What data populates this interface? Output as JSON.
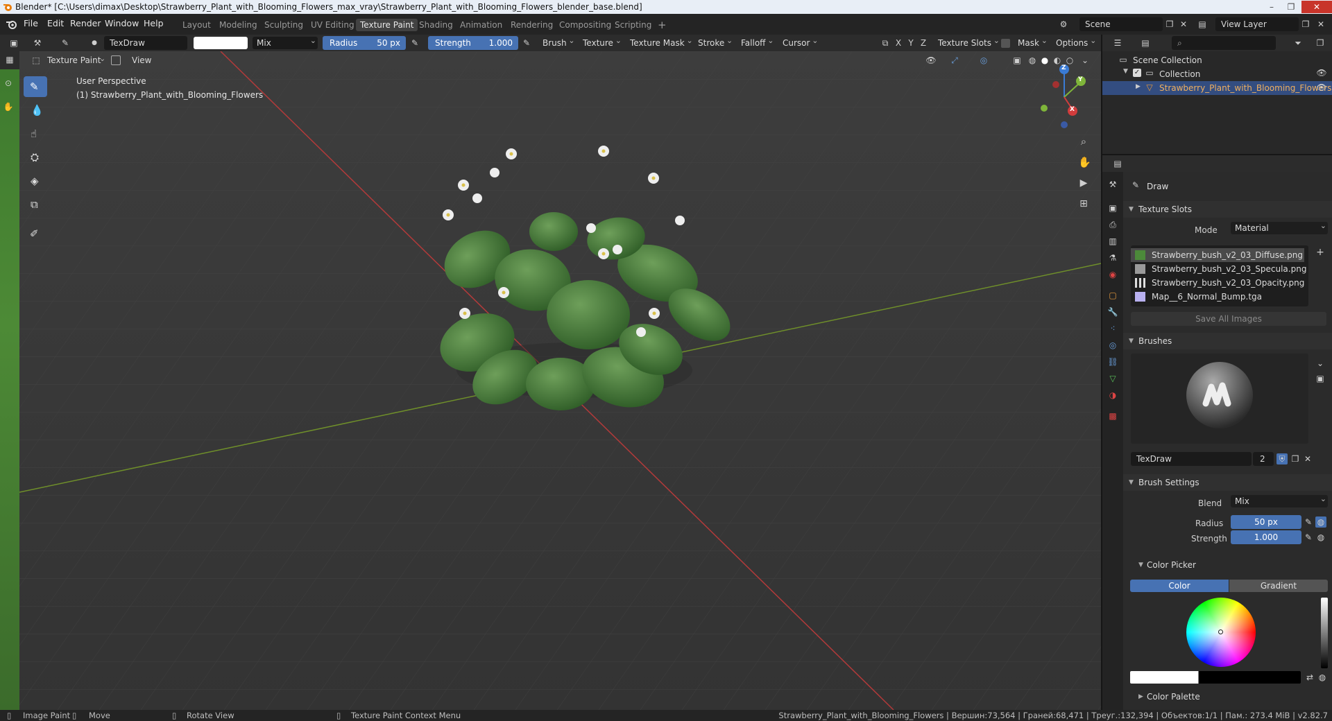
{
  "window": {
    "title": "Blender* [C:\\Users\\dimax\\Desktop\\Strawberry_Plant_with_Blooming_Flowers_max_vray\\Strawberry_Plant_with_Blooming_Flowers_blender_base.blend]"
  },
  "menu": {
    "items": [
      "File",
      "Edit",
      "Render",
      "Window",
      "Help"
    ]
  },
  "workspaces": [
    "Layout",
    "Modeling",
    "Sculpting",
    "UV Editing",
    "Texture Paint",
    "Shading",
    "Animation",
    "Rendering",
    "Compositing",
    "Scripting"
  ],
  "active_workspace": "Texture Paint",
  "scene": {
    "name": "Scene",
    "view_layer": "View Layer"
  },
  "tool_header": {
    "brush_name": "TexDraw",
    "blend": "Mix",
    "radius_label": "Radius",
    "radius_value": "50 px",
    "strength_label": "Strength",
    "strength_value": "1.000",
    "menus": [
      "Brush",
      "Texture",
      "Texture Mask",
      "Stroke",
      "Falloff",
      "Cursor"
    ],
    "axes": [
      "X",
      "Y",
      "Z"
    ],
    "texture_slots": "Texture Slots",
    "mask": "Mask",
    "options": "Options"
  },
  "viewport_header": {
    "mode": "Texture Paint",
    "view": "View"
  },
  "viewport": {
    "perspective": "User Perspective",
    "object_label": "(1) Strawberry_Plant_with_Blooming_Flowers",
    "gizmo": {
      "z": "Z",
      "y": "Y",
      "x": "X"
    }
  },
  "outliner": {
    "scene_collection": "Scene Collection",
    "collection": "Collection",
    "object": "Strawberry_Plant_with_Blooming_Flowers"
  },
  "properties": {
    "tool_name": "Draw",
    "texture_slots_title": "Texture Slots",
    "mode_label": "Mode",
    "mode_value": "Material",
    "slots": [
      {
        "name": "Strawberry_bush_v2_03_Diffuse.png",
        "color": "#4c8a3a",
        "selected": true
      },
      {
        "name": "Strawberry_bush_v2_03_Specula.png",
        "color": "#9a9a9a",
        "selected": false
      },
      {
        "name": "Strawberry_bush_v2_03_Opacity.png",
        "color": "#dddddd",
        "selected": false
      },
      {
        "name": "Map__6_Normal_Bump.tga",
        "color": "#b8b0f0",
        "selected": false
      }
    ],
    "save_all": "Save All Images",
    "brushes_title": "Brushes",
    "brush_name": "TexDraw",
    "brush_users": "2",
    "brush_settings_title": "Brush Settings",
    "blend_label": "Blend",
    "blend_value": "Mix",
    "radius_label": "Radius",
    "radius_value": "50 px",
    "strength_label": "Strength",
    "strength_value": "1.000",
    "color_picker_title": "Color Picker",
    "color_tab": "Color",
    "gradient_tab": "Gradient",
    "color_palette_title": "Color Palette"
  },
  "statusbar": {
    "image_paint": "Image Paint",
    "move": "Move",
    "rotate": "Rotate View",
    "context_menu": "Texture Paint Context Menu",
    "stats": "Strawberry_Plant_with_Blooming_Flowers | Вершин:73,564 | Граней:68,471 | Треуг.:132,394 | Объектов:1/1 | Пам.: 273.4 MiB | v2.82.7"
  },
  "colors": {
    "accent": "#4772b3",
    "bg_dark": "#1d1d1d",
    "viewport_bg": "#3a3a3a",
    "leaf": "#3f7a33"
  }
}
